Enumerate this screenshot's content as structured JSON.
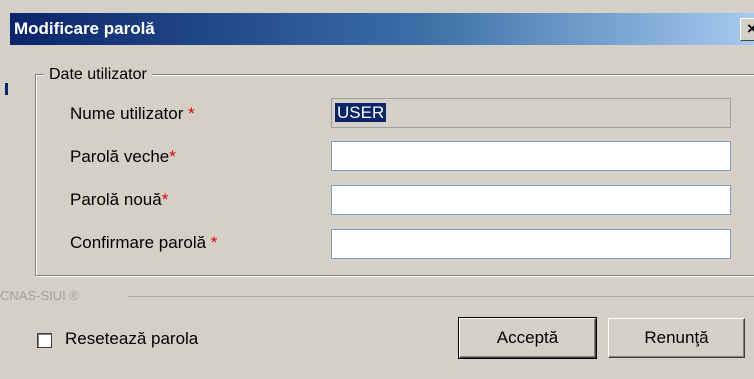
{
  "window": {
    "title": "Modificare parolă",
    "close_label": "×"
  },
  "groupbox": {
    "legend": "Date utilizator"
  },
  "fields": [
    {
      "label": "Nume utilizator ",
      "required": "*",
      "value": "USER",
      "readonly": true
    },
    {
      "label": "Parolă veche",
      "required": "*",
      "value": ""
    },
    {
      "label": "Parolă nouă",
      "required": "*",
      "value": ""
    },
    {
      "label": "Confirmare parolă ",
      "required": "*",
      "value": ""
    }
  ],
  "footer": {
    "brand": "CNAS-SIUI ®",
    "reset_label": "Resetează parola",
    "reset_checked": false,
    "ok_label": "Acceptă",
    "cancel_label": "Renunţă"
  },
  "colors": {
    "title_bar_start": "#0a246a",
    "title_bar_end": "#a6caf0",
    "required_star": "#e00000",
    "dialog_bg": "#d4d0c8"
  }
}
